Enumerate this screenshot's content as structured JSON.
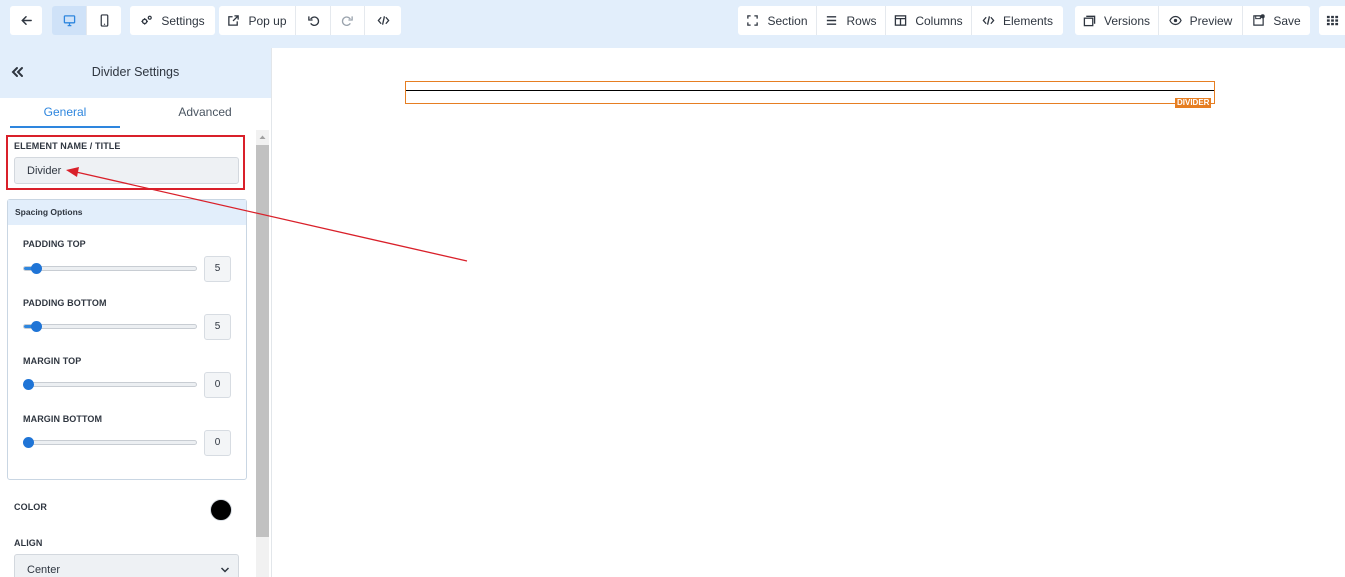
{
  "toolbar": {
    "settings_label": "Settings",
    "popup_label": "Pop up",
    "section_label": "Section",
    "rows_label": "Rows",
    "columns_label": "Columns",
    "elements_label": "Elements",
    "versions_label": "Versions",
    "preview_label": "Preview",
    "save_label": "Save",
    "icons": [
      "back-arrow-icon",
      "desktop-icon",
      "mobile-icon",
      "cogs-icon",
      "external-link-icon",
      "undo-icon",
      "redo-icon",
      "code-icon",
      "section-icon",
      "rows-icon",
      "columns-icon",
      "code-icon",
      "versions-icon",
      "eye-icon",
      "save-icon",
      "grid-icon"
    ]
  },
  "panel": {
    "title": "Divider Settings",
    "tabs": [
      {
        "label": "General",
        "active": true
      },
      {
        "label": "Advanced",
        "active": false
      }
    ],
    "element_name": {
      "label": "ELEMENT NAME / TITLE",
      "value": "Divider"
    },
    "spacing": {
      "title": "Spacing Options",
      "items": [
        {
          "label": "PADDING TOP",
          "value": "5",
          "fraction": 0.05
        },
        {
          "label": "PADDING BOTTOM",
          "value": "5",
          "fraction": 0.05
        },
        {
          "label": "MARGIN TOP",
          "value": "0",
          "fraction": 0.0
        },
        {
          "label": "MARGIN BOTTOM",
          "value": "0",
          "fraction": 0.0
        }
      ]
    },
    "color": {
      "label": "COLOR",
      "value": "#000000"
    },
    "align": {
      "label": "ALIGN",
      "value": "Center"
    }
  },
  "canvas": {
    "divider_tag": "DIVIDER"
  },
  "colors": {
    "accent": "#2e86de",
    "toolbar_bg": "#e2eefb",
    "highlight_border": "#e67e22",
    "annotation_red": "#d9202a"
  }
}
